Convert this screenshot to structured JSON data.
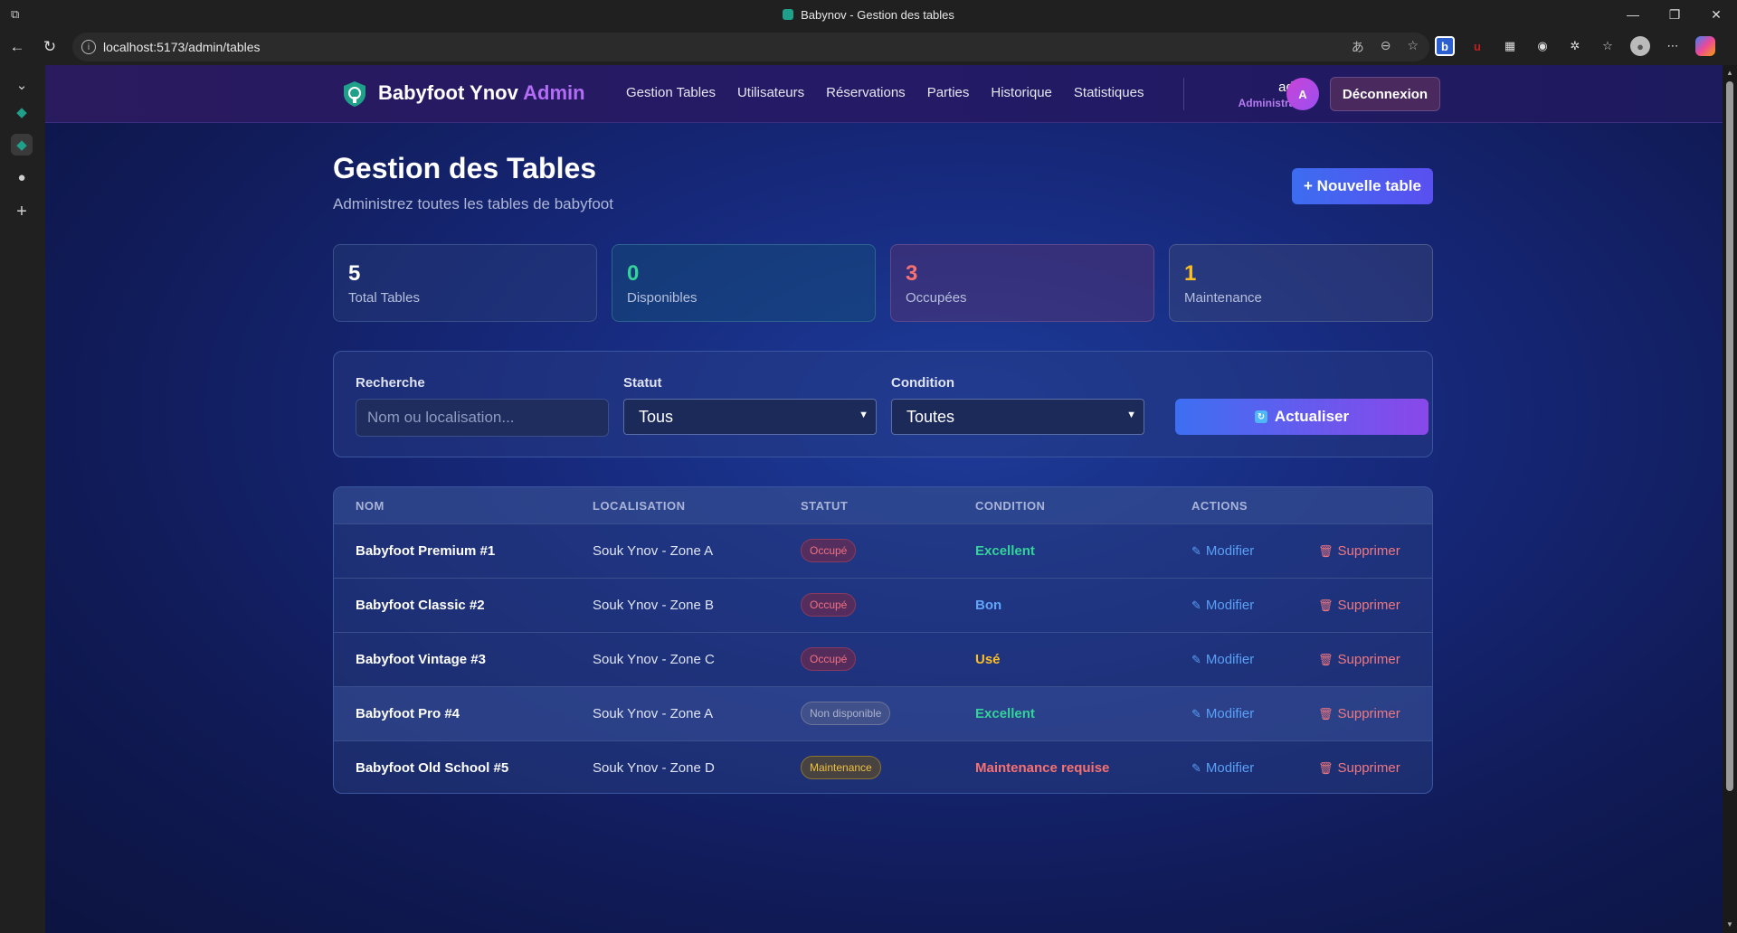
{
  "browser": {
    "window_title": "Babynov - Gestion des tables",
    "url": "localhost:5173/admin/tables"
  },
  "app": {
    "brand_main": "Babyfoot Ynov",
    "brand_accent": "Admin",
    "nav": [
      "Gestion Tables",
      "Utilisateurs",
      "Réservations",
      "Parties",
      "Historique",
      "Statistiques"
    ],
    "user_name": "admin",
    "user_role": "Administrateur",
    "avatar_initial": "A",
    "logout_label": "Déconnexion"
  },
  "page": {
    "title": "Gestion des Tables",
    "subtitle": "Administrez toutes les tables de babyfoot",
    "new_button": "+ Nouvelle table"
  },
  "stats": [
    {
      "value": "5",
      "label": "Total Tables",
      "color": "#ffffff"
    },
    {
      "value": "0",
      "label": "Disponibles",
      "color": "#34d399"
    },
    {
      "value": "3",
      "label": "Occupées",
      "color": "#f87171"
    },
    {
      "value": "1",
      "label": "Maintenance",
      "color": "#fbbf24"
    }
  ],
  "filters": {
    "search_label": "Recherche",
    "search_placeholder": "Nom ou localisation...",
    "status_label": "Statut",
    "status_value": "Tous",
    "condition_label": "Condition",
    "condition_value": "Toutes",
    "refresh_label": "Actualiser"
  },
  "table": {
    "headers": [
      "NOM",
      "LOCALISATION",
      "STATUT",
      "CONDITION",
      "ACTIONS"
    ],
    "edit_label": "Modifier",
    "delete_label": "Supprimer",
    "rows": [
      {
        "name": "Babyfoot Premium #1",
        "location": "Souk Ynov - Zone A",
        "status": "Occupé",
        "condition": "Excellent",
        "condition_color": "#34d399"
      },
      {
        "name": "Babyfoot Classic #2",
        "location": "Souk Ynov - Zone B",
        "status": "Occupé",
        "condition": "Bon",
        "condition_color": "#60a5fa"
      },
      {
        "name": "Babyfoot Vintage #3",
        "location": "Souk Ynov - Zone C",
        "status": "Occupé",
        "condition": "Usé",
        "condition_color": "#fbbf24"
      },
      {
        "name": "Babyfoot Pro #4",
        "location": "Souk Ynov - Zone A",
        "status": "Non disponible",
        "condition": "Excellent",
        "condition_color": "#34d399"
      },
      {
        "name": "Babyfoot Old School #5",
        "location": "Souk Ynov - Zone D",
        "status": "Maintenance",
        "condition": "Maintenance requise",
        "condition_color": "#f87171"
      }
    ]
  }
}
